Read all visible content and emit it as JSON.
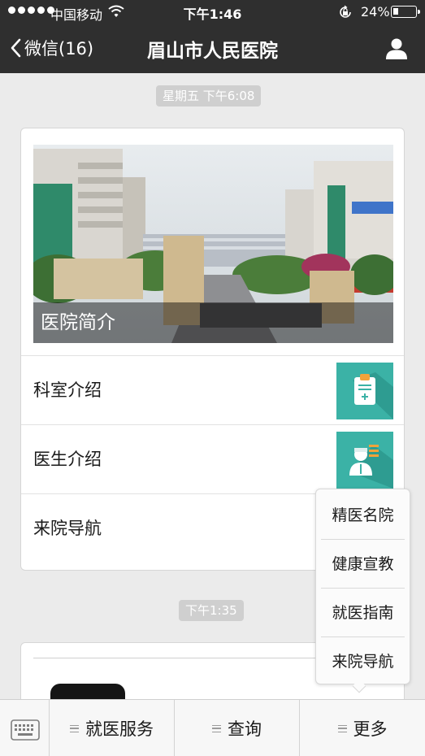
{
  "status_bar": {
    "carrier": "中国移动",
    "time": "下午1:46",
    "battery": "24%",
    "battery_level": 0.24
  },
  "nav": {
    "back_label": "微信(16)",
    "title": "眉山市人民医院"
  },
  "chat": {
    "timestamp_1": "星期五 下午6:08",
    "timestamp_2": "下午1:35",
    "article": {
      "cover_caption": "医院简介",
      "items": [
        {
          "label": "科室介绍",
          "icon": "clipboard-icon"
        },
        {
          "label": "医生介绍",
          "icon": "doctor-icon"
        },
        {
          "label": "来院导航",
          "icon": "navigation-icon"
        }
      ]
    }
  },
  "popup_menu": {
    "items": [
      "精医名院",
      "健康宣教",
      "就医指南",
      "来院导航"
    ]
  },
  "bottom_menu": {
    "items": [
      "就医服务",
      "查询",
      "更多"
    ]
  },
  "colors": {
    "nav_bg": "#2f2f2f",
    "thumb_teal": "#3bb2a6",
    "chat_bg": "#ebebeb"
  }
}
